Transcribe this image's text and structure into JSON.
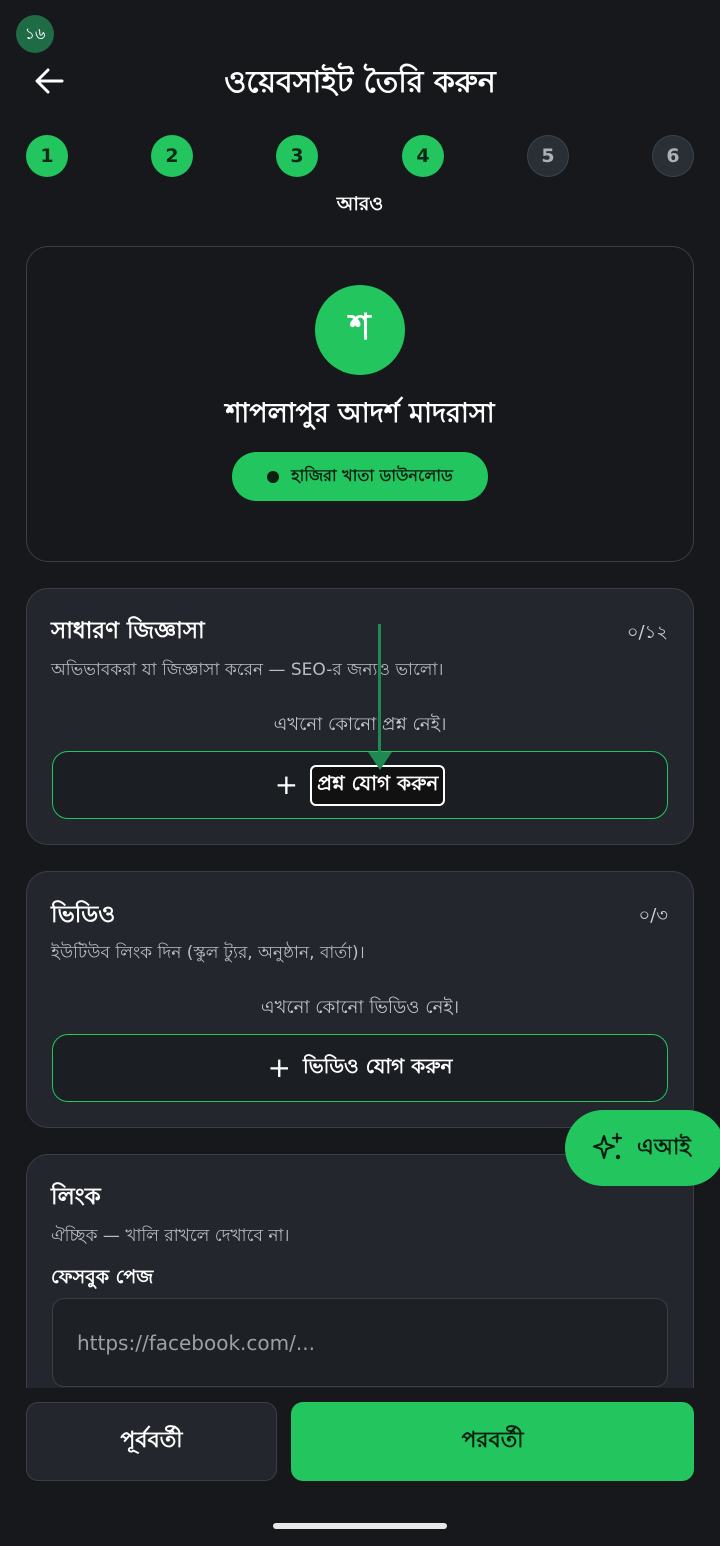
{
  "status": {
    "badge": "১৬"
  },
  "header": {
    "title": "ওয়েবসাইট তৈরি করুন"
  },
  "stepper": {
    "steps": [
      "1",
      "2",
      "3",
      "4",
      "5",
      "6"
    ],
    "current_caption": "আরও"
  },
  "profile": {
    "avatar_letter": "শ",
    "name": "শাপলাপুর আদর্শ মাদরাসা",
    "pill_label": "হাজিরা খাতা ডাউনলোড"
  },
  "faq": {
    "title": "সাধারণ জিজ্ঞাসা",
    "count": "০/১২",
    "description": "অভিভাবকরা যা জিজ্ঞাসা করেন — SEO-র জন্যও ভালো।",
    "empty": "এখনো কোনো প্রশ্ন নেই।",
    "add_label": "প্রশ্ন যোগ করুন"
  },
  "video": {
    "title": "ভিডিও",
    "count": "০/৩",
    "description": "ইউটিউব লিংক দিন (স্কুল ট্যুর, অনুষ্ঠান, বার্তা)।",
    "empty": "এখনো কোনো ভিডিও নেই।",
    "add_label": "ভিডিও যোগ করুন"
  },
  "links": {
    "title": "লিংক",
    "description": "ঐচ্ছিক — খালি রাখলে দেখাবে না।",
    "facebook_label": "ফেসবুক পেজ",
    "facebook_placeholder": "https://facebook.com/..."
  },
  "ai_fab": {
    "label": "এআই"
  },
  "footer": {
    "prev_label": "পূর্ববর্তী",
    "next_label": "পরবর্তী"
  },
  "colors": {
    "accent": "#22c55e",
    "background": "#16181b",
    "panel": "#23272d"
  }
}
